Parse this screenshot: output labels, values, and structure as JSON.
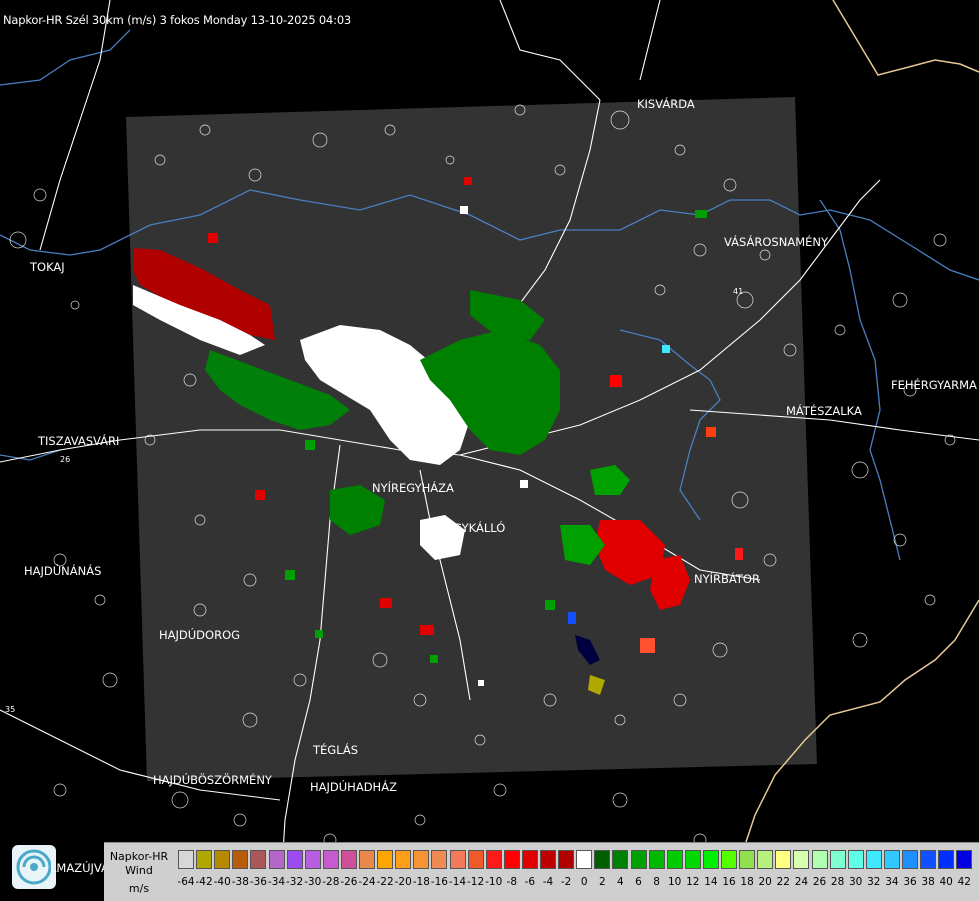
{
  "header": {
    "title": "Napkor-HR Szél 30km (m/s) 3 fokos Monday 13-10-2025 04:03"
  },
  "towns": [
    {
      "id": "kisvarda",
      "label": "KISVÁRDA"
    },
    {
      "id": "tokaj",
      "label": "TOKAJ"
    },
    {
      "id": "vasarosnameny",
      "label": "VÁSÁROSNAMÉNY"
    },
    {
      "id": "fehergyarmat",
      "label": "FEHÉRGYARMA"
    },
    {
      "id": "mateszalka",
      "label": "MÁTÉSZALKA"
    },
    {
      "id": "tiszavasvari",
      "label": "TISZAVASVÁRI"
    },
    {
      "id": "nyiregyhaza",
      "label": "NYÍREGYHÁZA"
    },
    {
      "id": "nagykallo",
      "label": "NAGYKÁLLÓ"
    },
    {
      "id": "nyirbator",
      "label": "NYÍRBÁTOR"
    },
    {
      "id": "hajdunanas",
      "label": "HAJDÚNÁNÁS"
    },
    {
      "id": "hajdudorog",
      "label": "HAJDÚDOROG"
    },
    {
      "id": "teglas",
      "label": "TÉGLÁS"
    },
    {
      "id": "hajduboszormeny",
      "label": "HAJDÚBÖSZÖRMÉNY"
    },
    {
      "id": "hajduhadhaz",
      "label": "HAJDÚHADHÁZ"
    }
  ],
  "road_numbers": [
    "26",
    "35",
    "41"
  ],
  "legend": {
    "line1": "Napkor-HR",
    "line2": "Wind",
    "line3": "m/s",
    "ticks": [
      "-64",
      "-42",
      "-40",
      "-38",
      "-36",
      "-34",
      "-32",
      "-30",
      "-28",
      "-26",
      "-24",
      "-22",
      "-20",
      "-18",
      "-16",
      "-14",
      "-12",
      "-10",
      "-8",
      "-6",
      "-4",
      "-2",
      "0",
      "2",
      "4",
      "6",
      "8",
      "10",
      "12",
      "14",
      "16",
      "18",
      "20",
      "22",
      "24",
      "26",
      "28",
      "30",
      "32",
      "34",
      "36",
      "38",
      "40",
      "42"
    ],
    "colors": [
      "#d7d7d7",
      "#b0a800",
      "#b58a00",
      "#b85c0b",
      "#a9575b",
      "#b467c8",
      "#9b4cf0",
      "#b75de0",
      "#c65ad0",
      "#cf5098",
      "#e8884a",
      "#ffa500",
      "#ff9e1a",
      "#f59335",
      "#ee8a54",
      "#f07a5a",
      "#f05a2a",
      "#ff1a1a",
      "#ff0000",
      "#e00000",
      "#c00000",
      "#b00000",
      "#ffffff",
      "#006000",
      "#008000",
      "#00a000",
      "#00b800",
      "#00cc00",
      "#00d800",
      "#00ee00",
      "#55ff00",
      "#90e050",
      "#b8f080",
      "#ffff80",
      "#d8ffb0",
      "#b0ffb0",
      "#80ffd0",
      "#60ffe8",
      "#40e8ff",
      "#30c8ff",
      "#2090ff",
      "#1050ff",
      "#0030ff",
      "#0000e0"
    ]
  },
  "logo": {
    "text": "LMAZÚJVÁR"
  }
}
